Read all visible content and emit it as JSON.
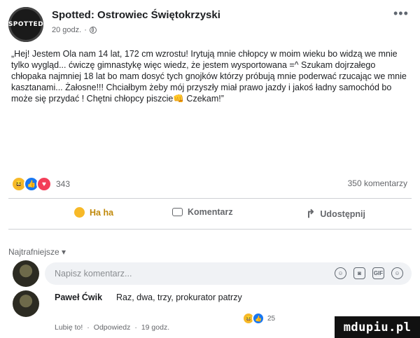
{
  "post": {
    "author_name": "Spotted: Ostrowiec Świętokrzyski",
    "avatar_text": "SPOTTED",
    "time": "20 godz.",
    "text": "„Hej! Jestem Ola nam 14 lat, 172 cm wzrostu! Irytują mnie chłopcy w moim wieku bo widzą we mnie tylko wygląd... ćwiczę gimnastykę więc wiedz, że jestem wysportowana =^ Szukam dojrzałego chłopaka najmniej 18 lat bo mam dosyć tych gnojków którzy próbują mnie poderwać rzucając we mnie kasztanami... Żałosne!!! Chciałbym żeby mój przyszły miał prawo jazdy i jakoś ładny samochód bo może się przydać ! Chętni chłopcy piszcie",
    "text_end": " Czekam!”",
    "text_emoji": "👊",
    "more_glyph": "•••"
  },
  "stats": {
    "reaction_count": "343",
    "comments_count": "350 komentarzy"
  },
  "actions": {
    "haha_label": "Ha ha",
    "comment_label": "Komentarz",
    "share_label": "Udostępnij"
  },
  "comments": {
    "sort_label": "Najtrafniejsze ▾",
    "input_placeholder": "Napisz komentarz...",
    "icon_emoji": "☺",
    "icon_camera": "◙",
    "icon_gif": "GIF",
    "icon_sticker": "☺",
    "items": [
      {
        "author": "Paweł Ćwik",
        "text": "Raz, dwa, trzy, prokurator patrzy",
        "like_action": "Lubię to!",
        "sep": "·",
        "reply_action": "Odpowiedz",
        "time": "19 godz.",
        "reaction_count": "25"
      }
    ]
  },
  "watermark": "mdupiu.pl",
  "colors": {
    "haha": "#f7b928",
    "like": "#1877f2",
    "love": "#f33e58",
    "muted_text": "#65676b"
  }
}
